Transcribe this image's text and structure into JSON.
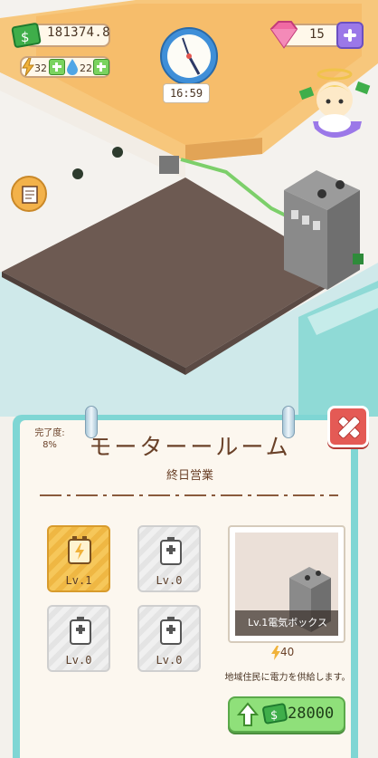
{
  "hud": {
    "money": "181374.8",
    "energy": "32",
    "water": "22",
    "gems": "15",
    "clock_time": "16:59"
  },
  "panel": {
    "progress_label": "完了度:",
    "progress_value": "8%",
    "title": "モーターールーム",
    "subtitle": "終日営業",
    "slots": [
      {
        "level": "Lv.1",
        "state": "active"
      },
      {
        "level": "Lv.0",
        "state": "locked"
      },
      {
        "level": "Lv.0",
        "state": "locked"
      },
      {
        "level": "Lv.0",
        "state": "locked"
      }
    ],
    "preview_caption": "Lv.1電気ボックス",
    "power_value": "40",
    "description": "地域住民に電力を供給します。",
    "upgrade_cost": "28000"
  },
  "colors": {
    "panel_border": "#7fd6d4",
    "close": "#e45a55",
    "upgrade": "#8fe07a",
    "active_slot": "#f6c75a"
  }
}
